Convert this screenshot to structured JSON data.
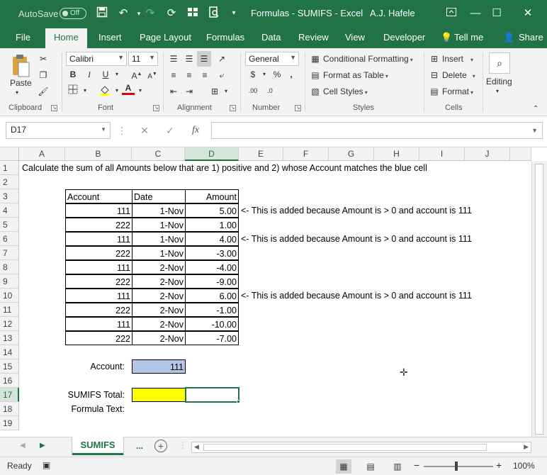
{
  "titlebar": {
    "autosave_label": "AutoSave",
    "autosave_state": "Off",
    "title": "Formulas - SUMIFS  -  Excel",
    "user": "A.J. Hafele"
  },
  "tabs": [
    "File",
    "Home",
    "Insert",
    "Page Layout",
    "Formulas",
    "Data",
    "Review",
    "View",
    "Developer",
    "Tell me",
    "Share"
  ],
  "ribbon": {
    "clipboard": {
      "label": "Clipboard",
      "paste": "Paste"
    },
    "font": {
      "label": "Font",
      "name": "Calibri",
      "size": "11"
    },
    "alignment": {
      "label": "Alignment"
    },
    "number": {
      "label": "Number",
      "format": "General"
    },
    "styles": {
      "label": "Styles",
      "conditional": "Conditional Formatting",
      "format_table": "Format as Table",
      "cell_styles": "Cell Styles"
    },
    "cells": {
      "label": "Cells",
      "insert": "Insert",
      "delete": "Delete",
      "format": "Format"
    },
    "editing": {
      "label": "Editing"
    }
  },
  "formula_bar": {
    "name_box": "D17",
    "value": ""
  },
  "columns": [
    "A",
    "B",
    "C",
    "D",
    "E",
    "F",
    "G",
    "H",
    "I",
    "J"
  ],
  "rows": [
    "1",
    "2",
    "3",
    "4",
    "5",
    "6",
    "7",
    "8",
    "9",
    "10",
    "11",
    "12",
    "13",
    "14",
    "15",
    "16",
    "17",
    "18",
    "19"
  ],
  "sheet": {
    "r1": "Calculate the sum of all Amounts below that are 1) positive and 2) whose Account matches the blue cell",
    "headers": [
      "Account",
      "Date",
      "Amount"
    ],
    "table": [
      [
        "111",
        "1-Nov",
        "5.00"
      ],
      [
        "222",
        "1-Nov",
        "1.00"
      ],
      [
        "111",
        "1-Nov",
        "4.00"
      ],
      [
        "222",
        "1-Nov",
        "-3.00"
      ],
      [
        "111",
        "2-Nov",
        "-4.00"
      ],
      [
        "222",
        "2-Nov",
        "-9.00"
      ],
      [
        "111",
        "2-Nov",
        "6.00"
      ],
      [
        "222",
        "2-Nov",
        "-1.00"
      ],
      [
        "111",
        "2-Nov",
        "-10.00"
      ],
      [
        "222",
        "2-Nov",
        "-7.00"
      ]
    ],
    "notes": {
      "r4": "<- This is added because Amount is > 0 and account is 111",
      "r6": "<- This is added because Amount is > 0 and account is 111",
      "r10": "<- This is added because Amount is > 0 and account is 111"
    },
    "account_label": "Account:",
    "account_value": "111",
    "sumifs_label": "SUMIFS Total:",
    "formula_text_label": "Formula Text:"
  },
  "sheet_tabs": {
    "active": "SUMIFS",
    "more": "..."
  },
  "status": {
    "ready": "Ready",
    "zoom": "100%"
  },
  "colors": {
    "excel_green": "#217346",
    "blue_cell": "#b4c6e7",
    "yellow_cell": "#ffff00"
  }
}
